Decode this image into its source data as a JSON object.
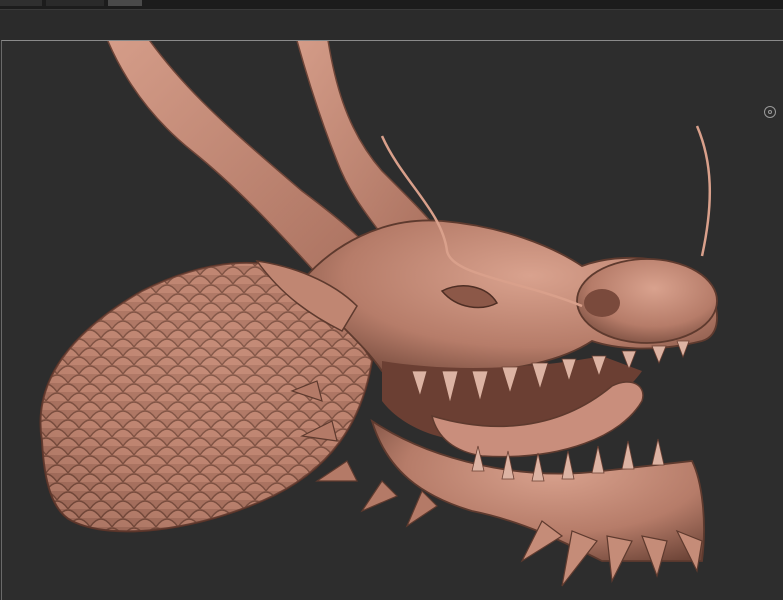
{
  "app": {
    "accent": "#c88e7a"
  },
  "toolbar": {
    "tabs": [
      {
        "icon": "tab"
      },
      {
        "icon": "tab"
      },
      {
        "icon": "tab-active"
      }
    ]
  },
  "viewport": {
    "background": "#2d2d2d",
    "model": {
      "subject": "dragon-head-sculpt",
      "material_color": "#c58c78"
    },
    "controls": {
      "camera_icon": "orbit-camera-icon"
    }
  }
}
